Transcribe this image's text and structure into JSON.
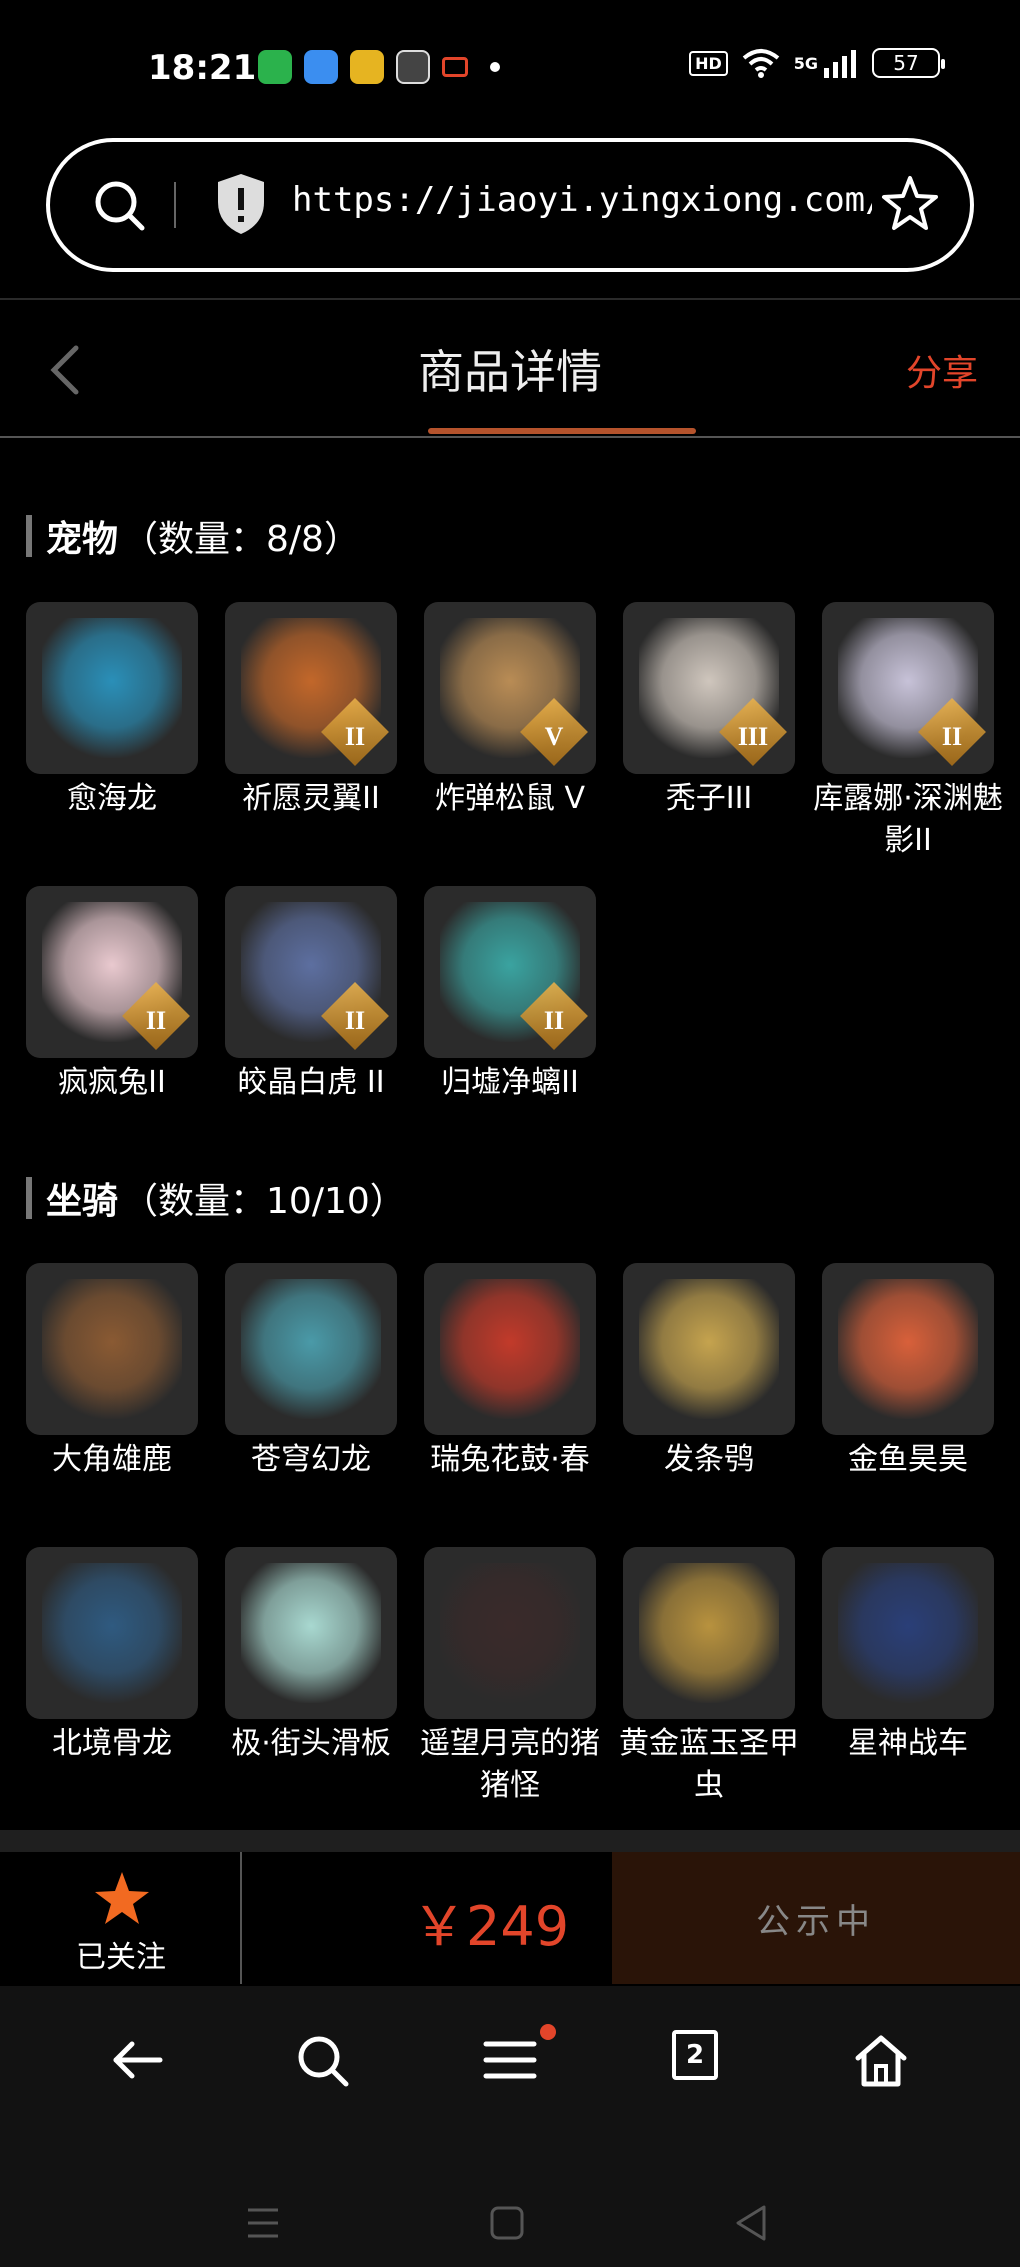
{
  "status_bar": {
    "time": "18:21",
    "network": "5G",
    "battery": "57",
    "hd_label": "HD"
  },
  "address_bar": {
    "url": "https://jiaoyi.yingxiong.com/goo···",
    "icons": [
      "search-icon",
      "shield-icon",
      "star-icon"
    ]
  },
  "header": {
    "title": "商品详情",
    "share": "分享"
  },
  "pets_section": {
    "title": "宠物",
    "count": "（数量：8/8）",
    "items": [
      {
        "name": "愈海龙",
        "tier": "",
        "color": "#2a8fb8"
      },
      {
        "name": "祈愿灵翼II",
        "tier": "II",
        "color": "#c2672a"
      },
      {
        "name": "炸弹松鼠 V",
        "tier": "V",
        "color": "#b98c55"
      },
      {
        "name": "秃子III",
        "tier": "III",
        "color": "#cfc6bd"
      },
      {
        "name": "库露娜·深渊魅影II",
        "tier": "II",
        "color": "#c7c2d8"
      },
      {
        "name": "疯疯兔II",
        "tier": "II",
        "color": "#e9c9cf"
      },
      {
        "name": "皎晶白虎 II",
        "tier": "II",
        "color": "#5d6fa0"
      },
      {
        "name": "归墟净螭II",
        "tier": "II",
        "color": "#3aa3a0"
      }
    ]
  },
  "mounts_section": {
    "title": "坐骑",
    "count": "（数量：10/10）",
    "items": [
      {
        "name": "大角雄鹿",
        "color": "#8a5a33"
      },
      {
        "name": "苍穹幻龙",
        "color": "#4a9aa8"
      },
      {
        "name": "瑞兔花鼓·春",
        "color": "#c23a2a"
      },
      {
        "name": "发条鸮",
        "color": "#c5a34e"
      },
      {
        "name": "金鱼昊昊",
        "color": "#d8603a"
      },
      {
        "name": "北境骨龙",
        "color": "#2f5a80"
      },
      {
        "name": "极·街头滑板",
        "color": "#a8d8d0"
      },
      {
        "name": "遥望月亮的猪猪怪",
        "color": "#3a2a2a"
      },
      {
        "name": "黄金蓝玉圣甲虫",
        "color": "#b8923e"
      },
      {
        "name": "星神战车",
        "color": "#2a3f78"
      }
    ]
  },
  "action_bar": {
    "follow_label": "已关注",
    "price": "￥249",
    "status_button": "公示中",
    "accent": "#e2452a"
  },
  "browser_toolbar": {
    "tab_count": "2"
  }
}
